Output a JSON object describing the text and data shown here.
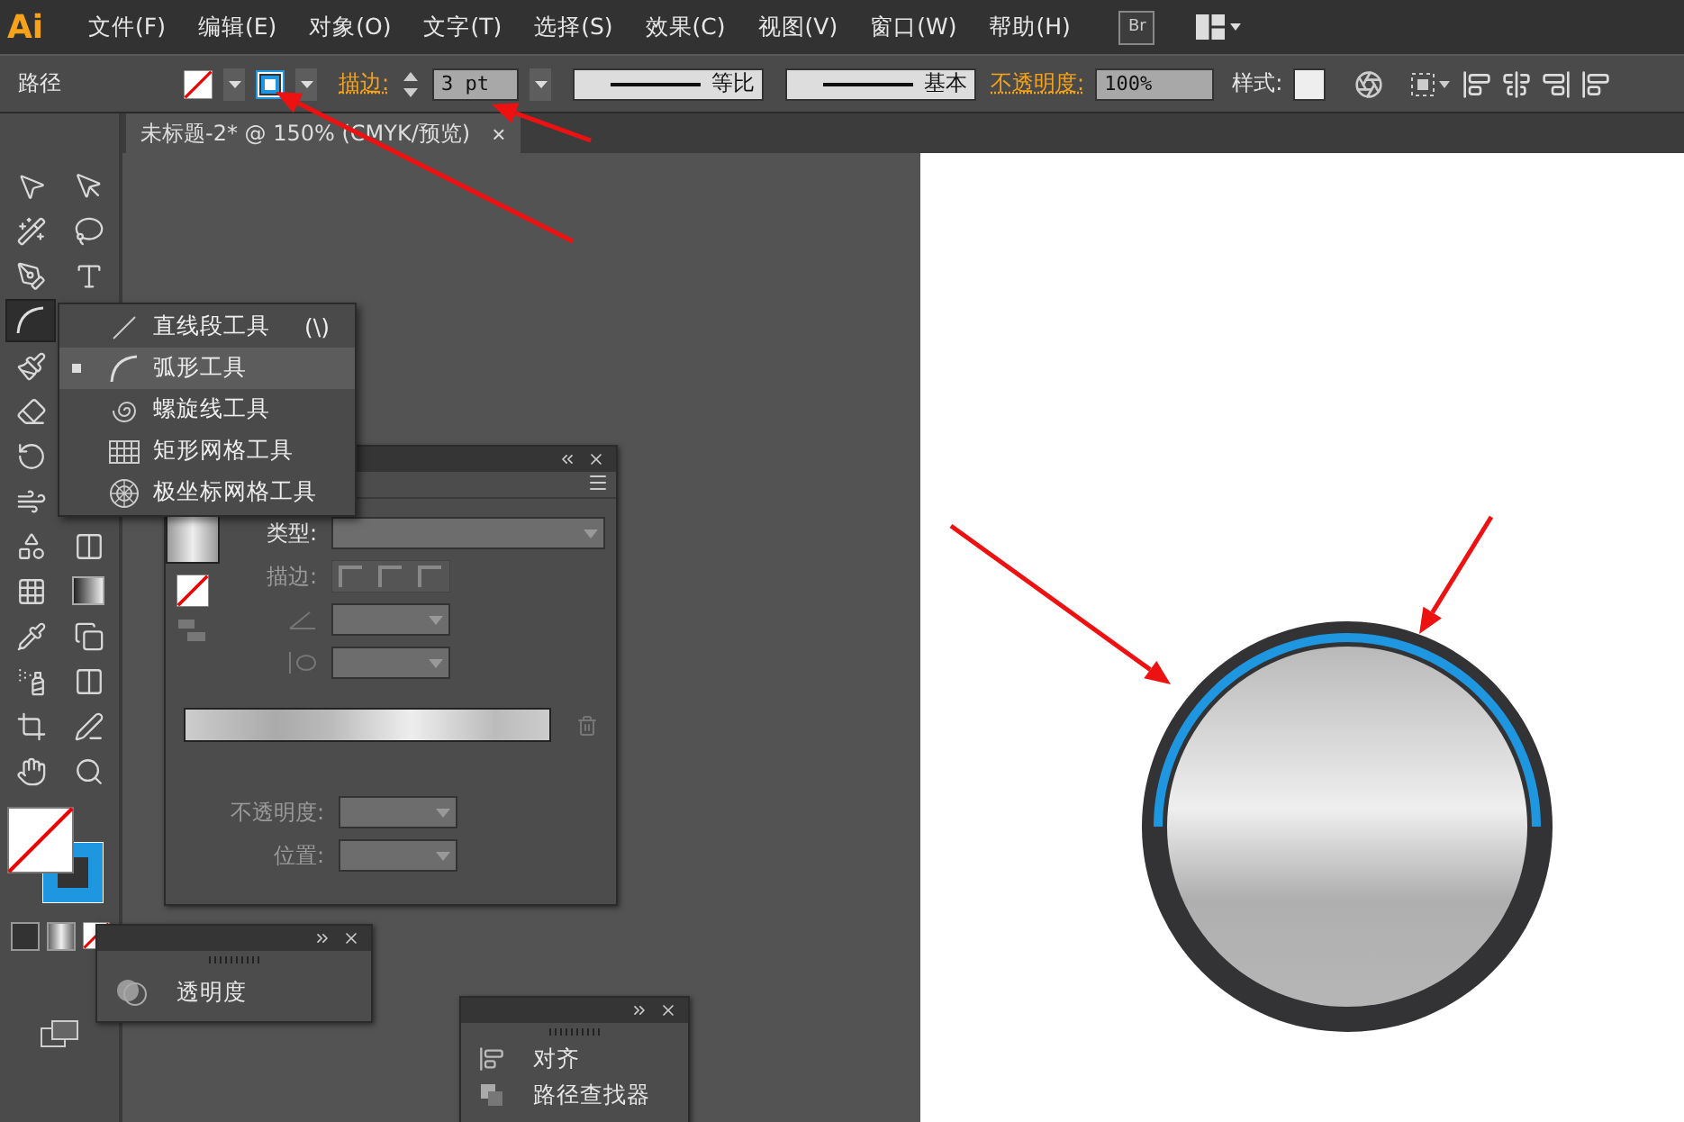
{
  "app_logo": "Ai",
  "menu": [
    "文件(F)",
    "编辑(E)",
    "对象(O)",
    "文字(T)",
    "选择(S)",
    "效果(C)",
    "视图(V)",
    "窗口(W)",
    "帮助(H)"
  ],
  "bridge_button": "Br",
  "control_bar": {
    "selection": "路径",
    "stroke_label": "描边:",
    "stroke_weight": "3 pt",
    "profile": "等比",
    "brush": "基本",
    "opacity_label": "不透明度:",
    "opacity": "100%",
    "style_label": "样式:"
  },
  "document_tab": {
    "title": "未标题-2* @ 150% (CMYK/预览)",
    "close": "×"
  },
  "tool_flyout": [
    {
      "kind": "line",
      "label": "直线段工具",
      "shortcut": "(\\)",
      "selected": false
    },
    {
      "kind": "arc",
      "label": "弧形工具",
      "selected": true
    },
    {
      "kind": "spiral",
      "label": "螺旋线工具",
      "selected": false
    },
    {
      "kind": "rect-grid",
      "label": "矩形网格工具",
      "selected": false
    },
    {
      "kind": "polar-grid",
      "label": "极坐标网格工具",
      "selected": false
    }
  ],
  "gradient_panel": {
    "type_label": "类型:",
    "stroke_label": "描边:",
    "opacity_label": "不透明度:",
    "position_label": "位置:"
  },
  "transparency_panel": {
    "label": "透明度"
  },
  "align_panel": {
    "items": [
      "对齐",
      "路径查找器"
    ]
  }
}
